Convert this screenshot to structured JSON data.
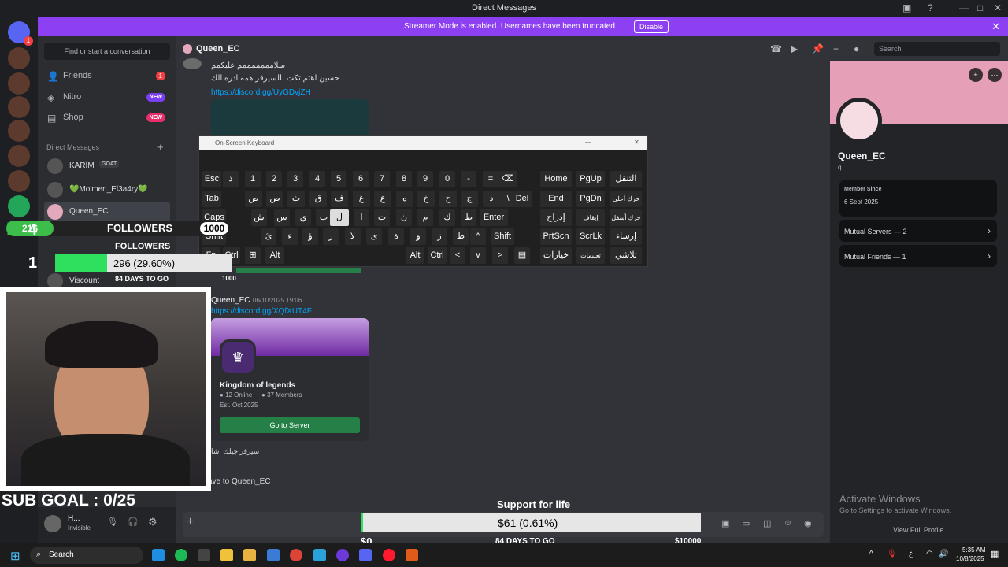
{
  "window": {
    "title": "Direct Messages"
  },
  "banner": {
    "text": "Streamer Mode is enabled. Usernames have been truncated.",
    "button": "Disable"
  },
  "rail": {
    "badge_count": "1"
  },
  "sidebar": {
    "find_placeholder": "Find or start a conversation",
    "nav": [
      {
        "label": "Friends",
        "badge": "1"
      },
      {
        "label": "Nitro",
        "badge": "NEW"
      },
      {
        "label": "Shop",
        "badge": "NEW"
      }
    ],
    "dm_header": "Direct Messages",
    "dms": [
      {
        "name": "KARÎM",
        "tag": "GOAT"
      },
      {
        "name": "💚Mo'men_El3a4ry💚"
      },
      {
        "name": "Queen_EC"
      },
      {
        "name": "Viscount"
      }
    ],
    "user": {
      "name": "H...",
      "status": "Invisible"
    }
  },
  "chat_header": {
    "name": "Queen_EC",
    "search_placeholder": "Search"
  },
  "messages": {
    "line1": "سلامممممممم عليكمم",
    "line2": "حسين اهتم تكت بالسيرفر همه ادره الك",
    "link1": "https://discord.gg/UyGDvjZH",
    "author": "Queen_EC",
    "timestamp": "06/10/2025 19:06",
    "link2": "https://discord.gg/XQfXUT4F",
    "invite": {
      "name": "Kingdom of legends",
      "online": "12 Online",
      "members": "37 Members",
      "est": "Est. Oct 2025",
      "button": "Go to Server"
    },
    "after": "سيرفر جيلك اشا",
    "leave_hint": "ave to Queen_EC"
  },
  "keyboard": {
    "title": "On-Screen Keyboard",
    "rows": [
      [
        "Esc",
        "ذ",
        "1",
        "2",
        "3",
        "4",
        "5",
        "6",
        "7",
        "8",
        "9",
        "0",
        "-",
        "=",
        "⌫",
        "Home",
        "PgUp",
        "التنقل"
      ],
      [
        "Tab",
        "ض",
        "ص",
        "ث",
        "ق",
        "ف",
        "غ",
        "ع",
        "ه",
        "خ",
        "ح",
        "ج",
        "د",
        "\\",
        "Del",
        "End",
        "PgDn",
        "حرك أعلى"
      ],
      [
        "Caps",
        "ش",
        "س",
        "ي",
        "ب",
        "ل",
        "ا",
        "ت",
        "ن",
        "م",
        "ك",
        "ط",
        "Enter",
        "إدراج",
        "إيقاف مؤقت",
        "حرك أسفل"
      ],
      [
        "Shift",
        "ئ",
        "ء",
        "ؤ",
        "ر",
        "لا",
        "ى",
        "ة",
        "و",
        "ز",
        "ظ",
        "^",
        "Shift",
        "PrtScn",
        "ScrLk",
        "إرساء"
      ],
      [
        "Fn",
        "Ctrl",
        "⊞",
        "Alt",
        "Alt",
        "Ctrl",
        "<",
        "v",
        ">",
        "▤",
        "خيارات",
        "تعليمات",
        "تلاشي"
      ]
    ]
  },
  "profile": {
    "name": "Queen_EC",
    "username": "q...",
    "member_since_label": "Member Since",
    "member_since": "6 Sept 2025",
    "mutual_servers": "Mutual Servers — 2",
    "mutual_friends": "Mutual Friends — 1",
    "view_full": "View Full Profile"
  },
  "overlay": {
    "followers_count": "216",
    "followers_label": "FOLLOWERS",
    "followers_goal": "1000",
    "followers_progress_text": "296 (29.60%)",
    "followers_progress": 0.296,
    "followers_sub": "FOLLOWERS",
    "days_to_go": "84 DAYS TO GO",
    "goal_end": "1000",
    "k_number": "4",
    "rank": "1",
    "sub_goal": "SUB GOAL : 0/25",
    "support_title": "Support for life",
    "support_text": "$61 (0.61%)",
    "support_progress": 0.0061,
    "support_start": "$0",
    "support_days": "84 DAYS TO GO",
    "support_end": "$10000"
  },
  "activate": {
    "title": "Activate Windows",
    "subtitle": "Go to Settings to activate Windows."
  },
  "taskbar": {
    "search": "Search",
    "time": "5:35 AM",
    "date": "10/8/2025",
    "lang": "ع"
  },
  "colors": {
    "accent": "#5865f2",
    "banner": "#8d3ff2",
    "green": "#248046",
    "red": "#f23f43",
    "link": "#00a8fc"
  }
}
